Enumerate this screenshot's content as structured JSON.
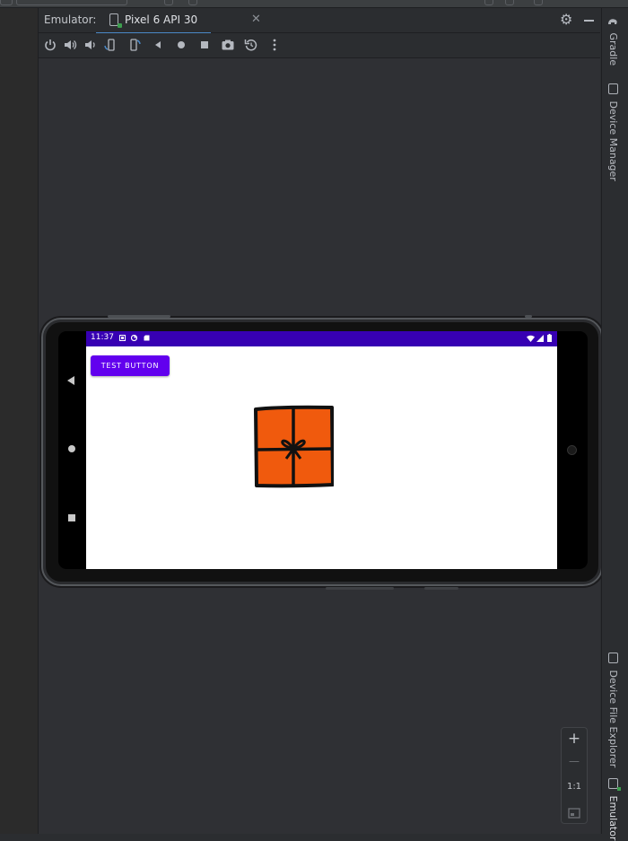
{
  "emulator_panel": {
    "label": "Emulator:",
    "tab_title": "Pixel 6 API 30",
    "tab_close": "✕",
    "settings_icon": "gear-icon",
    "minimize_icon": "minimize-icon"
  },
  "toolbar": {
    "buttons": [
      "power-icon",
      "volume-up-icon",
      "volume-down-icon",
      "rotate-left-icon",
      "rotate-right-icon",
      "back-icon",
      "home-icon",
      "overview-icon",
      "screenshot-icon",
      "snapshot-icon",
      "more-icon"
    ]
  },
  "device": {
    "status_bar": {
      "time": "11:37",
      "color": "#3700b3"
    },
    "app": {
      "button_label": "TEST BUTTON",
      "button_color": "#6200ee",
      "image": "gift-box-illustration",
      "image_color": "#f05a0d"
    }
  },
  "right_sidebar": {
    "tabs": [
      {
        "label": "Gradle",
        "icon": "gradle-elephant-icon"
      },
      {
        "label": "Device Manager",
        "icon": "device-manager-icon"
      },
      {
        "label": "Device File Explorer",
        "icon": "device-file-explorer-icon"
      },
      {
        "label": "Emulator",
        "icon": "emulator-icon"
      }
    ]
  },
  "zoom_controls": {
    "zoom_in": "+",
    "zoom_out": "—",
    "actual_size": "1:1",
    "fit_icon": "fit-screen-icon"
  }
}
